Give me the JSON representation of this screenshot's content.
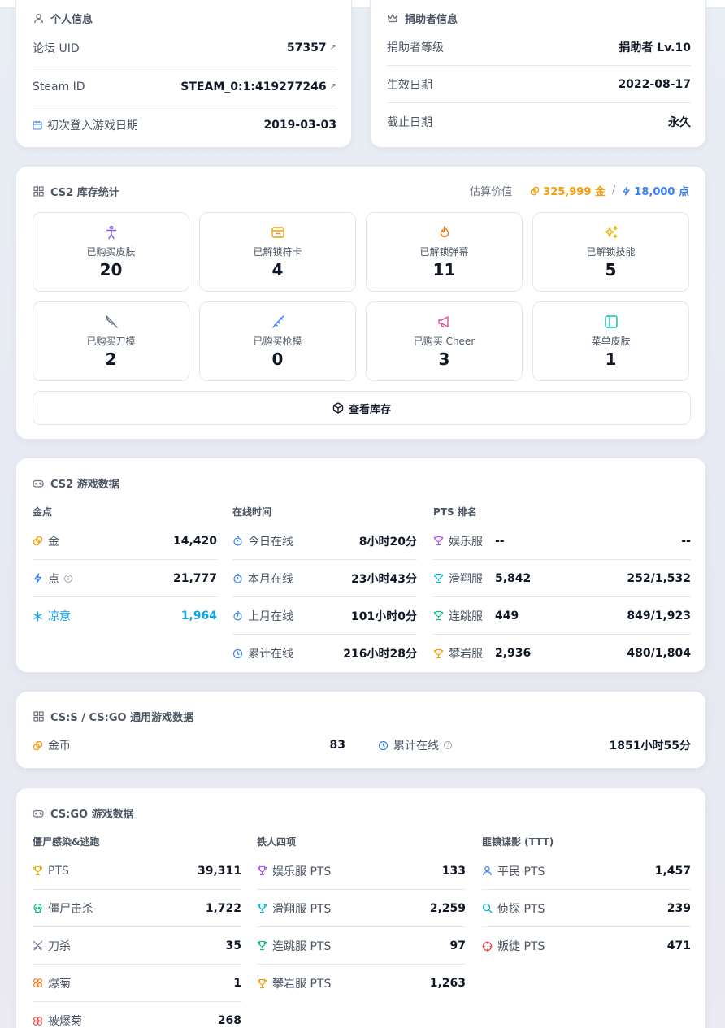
{
  "personal": {
    "title": "个人信息",
    "rows": [
      {
        "label": "论坛 UID",
        "value": "57357"
      },
      {
        "label": "Steam ID",
        "value": "STEAM_0:1:419277246"
      },
      {
        "label": "初次登入游戏日期",
        "value": "2019-03-03"
      }
    ]
  },
  "donor": {
    "title": "捐助者信息",
    "rows": [
      {
        "label": "捐助者等级",
        "value": "捐助者 Lv.10"
      },
      {
        "label": "生效日期",
        "value": "2022-08-17"
      },
      {
        "label": "截止日期",
        "value": "永久"
      }
    ]
  },
  "inventory": {
    "title": "CS2 库存统计",
    "estimate_label": "估算价值",
    "gold_value": "325,999 金",
    "separator": "/",
    "points_value": "18,000 点",
    "stats": [
      {
        "icon": "person-icon",
        "label": "已购买皮肤",
        "value": "20",
        "color": "#8b5cf6"
      },
      {
        "icon": "card-icon",
        "label": "已解锁符卡",
        "value": "4",
        "color": "#f59e0b"
      },
      {
        "icon": "flame-icon",
        "label": "已解锁弹幕",
        "value": "11",
        "color": "#f97316"
      },
      {
        "icon": "sparkles-icon",
        "label": "已解锁技能",
        "value": "5",
        "color": "#eab308"
      },
      {
        "icon": "knife-icon",
        "label": "已购买刀模",
        "value": "2",
        "color": "#64748b"
      },
      {
        "icon": "rifle-icon",
        "label": "已购买枪模",
        "value": "0",
        "color": "#3b82f6"
      },
      {
        "icon": "megaphone-icon",
        "label": "已购买 Cheer",
        "value": "3",
        "color": "#ec4899"
      },
      {
        "icon": "panel-icon",
        "label": "菜单皮肤",
        "value": "1",
        "color": "#14b8a6"
      }
    ],
    "button_label": "查看库存"
  },
  "cs2": {
    "title": "CS2 游戏数据",
    "gold": {
      "heading": "金点",
      "rows": [
        {
          "label": "金",
          "value": "14,420",
          "icon": "coin-icon"
        },
        {
          "label": "点",
          "value": "21,777",
          "icon": "bolt-icon"
        },
        {
          "label": "凉意",
          "value": "1,964",
          "icon": "snowflake-icon"
        }
      ]
    },
    "online": {
      "heading": "在线时间",
      "rows": [
        {
          "label": "今日在线",
          "value": "8小时20分"
        },
        {
          "label": "本月在线",
          "value": "23小时43分"
        },
        {
          "label": "上月在线",
          "value": "101小时0分"
        },
        {
          "label": "累计在线",
          "value": "216小时28分"
        }
      ]
    },
    "pts": {
      "heading": "PTS 排名",
      "rows": [
        {
          "label": "娱乐服",
          "pts": "--",
          "rank": "--",
          "color": "#a855f7"
        },
        {
          "label": "滑翔服",
          "pts": "5,842",
          "rank": "252/1,532",
          "color": "#06b6d4"
        },
        {
          "label": "连跳服",
          "pts": "449",
          "rank": "849/1,923",
          "color": "#10b981"
        },
        {
          "label": "攀岩服",
          "pts": "2,936",
          "rank": "480/1,804",
          "color": "#f59e0b"
        }
      ]
    }
  },
  "common": {
    "title": "CS:S / CS:GO 通用游戏数据",
    "coin_label": "金币",
    "coin_value": "83",
    "online_label": "累计在线",
    "online_value": "1851小时55分"
  },
  "csgo": {
    "title": "CS:GO 游戏数据",
    "ze": {
      "heading": "僵尸感染&逃跑",
      "rows": [
        {
          "label": "PTS",
          "value": "39,311",
          "color": "#eab308"
        },
        {
          "label": "僵尸击杀",
          "value": "1,722",
          "color": "#10b981"
        },
        {
          "label": "刀杀",
          "value": "35",
          "color": "#64748b"
        },
        {
          "label": "爆菊",
          "value": "1",
          "color": "#f97316"
        },
        {
          "label": "被爆菊",
          "value": "268",
          "color": "#ef4444"
        }
      ]
    },
    "iron": {
      "heading": "铁人四项",
      "rows": [
        {
          "label": "娱乐服 PTS",
          "value": "133",
          "color": "#a855f7"
        },
        {
          "label": "滑翔服 PTS",
          "value": "2,259",
          "color": "#06b6d4"
        },
        {
          "label": "连跳服 PTS",
          "value": "97",
          "color": "#10b981"
        },
        {
          "label": "攀岩服 PTS",
          "value": "1,263",
          "color": "#f59e0b"
        }
      ]
    },
    "ttt": {
      "heading": "匪镇谍影 (TTT)",
      "rows": [
        {
          "label": "平民 PTS",
          "value": "1,457",
          "color": "#3b82f6"
        },
        {
          "label": "侦探 PTS",
          "value": "239",
          "color": "#06b6d4"
        },
        {
          "label": "叛徒 PTS",
          "value": "471",
          "color": "#ef4444"
        }
      ]
    }
  }
}
